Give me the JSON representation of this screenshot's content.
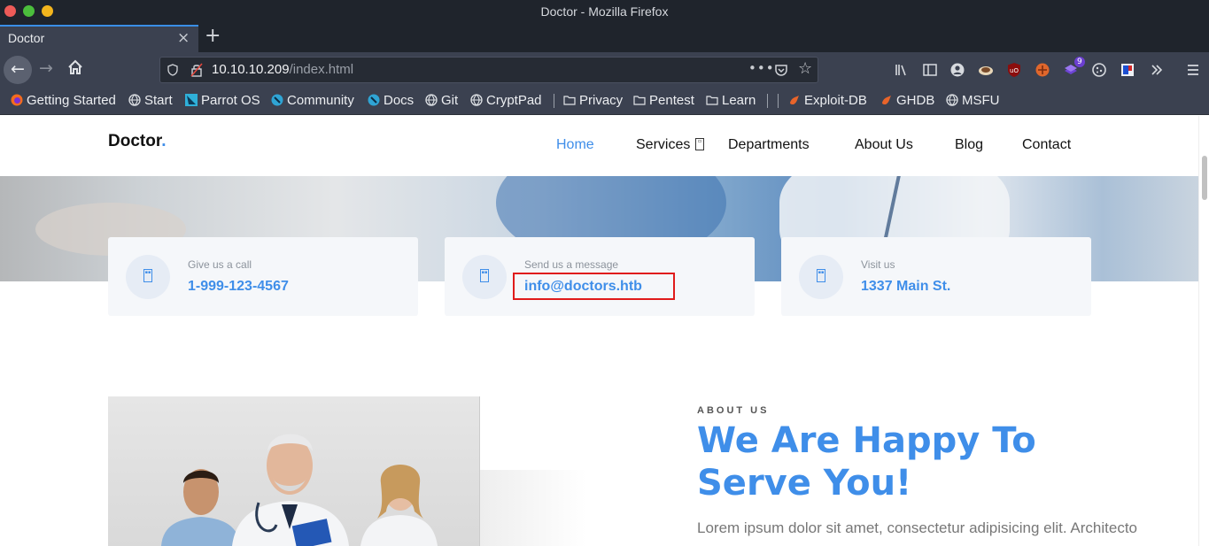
{
  "window": {
    "title": "Doctor - Mozilla Firefox"
  },
  "tab": {
    "title": "Doctor",
    "close": "×",
    "new_tab": "+"
  },
  "urlbar": {
    "host": "10.10.10.209",
    "path": "/index.html",
    "more": "•••",
    "star": "☆"
  },
  "nav": {
    "back": "←",
    "forward": "→"
  },
  "toolbar": {
    "extension_badge": "9"
  },
  "bookmarks": [
    {
      "label": "Getting Started",
      "icon": "firefox-icon"
    },
    {
      "label": "Start",
      "icon": "globe-icon"
    },
    {
      "label": "Parrot OS",
      "icon": "parrot-icon"
    },
    {
      "label": "Community",
      "icon": "parrot-community-icon"
    },
    {
      "label": "Docs",
      "icon": "parrot-docs-icon"
    },
    {
      "label": "Git",
      "icon": "globe-icon"
    },
    {
      "label": "CryptPad",
      "icon": "globe-icon"
    },
    {
      "label": "Privacy",
      "icon": "folder-icon"
    },
    {
      "label": "Pentest",
      "icon": "folder-icon"
    },
    {
      "label": "Learn",
      "icon": "folder-icon"
    },
    {
      "label": "Exploit-DB",
      "icon": "exploitdb-icon"
    },
    {
      "label": "GHDB",
      "icon": "exploitdb-icon"
    },
    {
      "label": "MSFU",
      "icon": "globe-icon"
    }
  ],
  "site": {
    "brand": "Doctor",
    "brand_dot": ".",
    "menu": [
      {
        "label": "Home",
        "active": true
      },
      {
        "label": "Services",
        "active": false
      },
      {
        "label": "Departments",
        "active": false
      },
      {
        "label": "About Us",
        "active": false
      },
      {
        "label": "Blog",
        "active": false
      },
      {
        "label": "Contact",
        "active": false
      }
    ],
    "info_cards": [
      {
        "label": "Give us a call",
        "value": "1-999-123-4567",
        "icon": "phone-icon"
      },
      {
        "label": "Send us a message",
        "value": "info@doctors.htb",
        "icon": "envelope-icon"
      },
      {
        "label": "Visit us",
        "value": "1337 Main St.",
        "icon": "map-pin-icon"
      }
    ],
    "about": {
      "kicker": "ABOUT US",
      "title": "We Are Happy To Serve You!",
      "text": "Lorem ipsum dolor sit amet, consectetur adipisicing elit. Architecto nemo quis doloremque hic consequuntur"
    }
  },
  "colors": {
    "accent": "#3f8ee9",
    "highlight": "#e01b1b",
    "chrome_dark": "#1f242c",
    "chrome": "#3b4150"
  }
}
